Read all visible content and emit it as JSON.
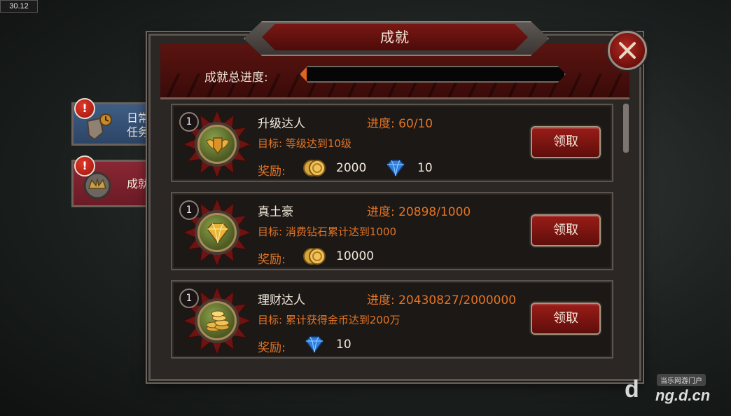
{
  "hud": {
    "fps": "30.12"
  },
  "window": {
    "title": "成就",
    "overall_progress_label": "成就总进度:",
    "overall_progress": 0.02
  },
  "tabs": [
    {
      "label": "日常\n任务",
      "alert": "!"
    },
    {
      "label": "成就",
      "alert": "!"
    }
  ],
  "achievements": [
    {
      "level": "1",
      "name": "升级达人",
      "progress": "进度:  60/10",
      "goal": "目标:  等级达到10级",
      "reward_label": "奖励:",
      "rewards": [
        {
          "icon": "gold-coin-icon",
          "value": "2000"
        },
        {
          "icon": "diamond-icon",
          "value": "10"
        }
      ],
      "claim_label": "领取",
      "medal": "winged-shield"
    },
    {
      "level": "1",
      "name": "真土豪",
      "progress": "进度:  20898/1000",
      "goal": "目标:  消费钻石累计达到1000",
      "reward_label": "奖励:",
      "rewards": [
        {
          "icon": "gold-coin-icon",
          "value": "10000"
        }
      ],
      "claim_label": "领取",
      "medal": "diamond"
    },
    {
      "level": "1",
      "name": "理财达人",
      "progress": "进度:  20430827/2000000",
      "goal": "目标:  累计获得金币达到200万",
      "reward_label": "奖励:",
      "rewards": [
        {
          "icon": "diamond-icon",
          "value": "10"
        }
      ],
      "claim_label": "领取",
      "medal": "coin-stack"
    }
  ],
  "watermark": {
    "logo": "d",
    "site": "ng.d.cn",
    "tag": "当乐网游门户"
  },
  "colors": {
    "accent_orange": "#e37425",
    "panel_red": "#5a1410",
    "daily_tab_blue": "#3f5d84",
    "achievement_tab_red": "#8a2734"
  }
}
